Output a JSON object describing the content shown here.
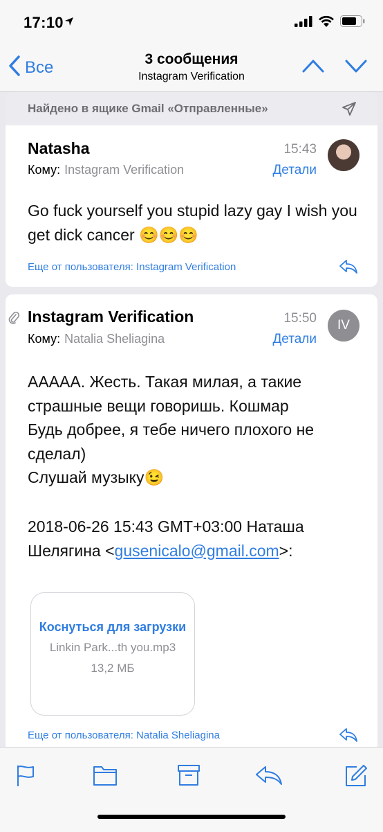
{
  "status_bar": {
    "time": "17:10"
  },
  "nav": {
    "back_label": "Все",
    "title": "3 сообщения",
    "subtitle": "Instagram Verification"
  },
  "found_banner": {
    "text": "Найдено в ящике Gmail «Отправленные»"
  },
  "messages": [
    {
      "sender": "Natasha",
      "to_label": "Кому:",
      "to_value": "Instagram Verification",
      "time": "15:43",
      "details_label": "Детали",
      "body": "Go fuck yourself you stupid lazy gay I wish you get dick cancer 😊😊😊",
      "more_from": "Еще от пользователя: Instagram Verification"
    },
    {
      "sender": "Instagram Verification",
      "to_label": "Кому:",
      "to_value": "Natalia Sheliagina",
      "time": "15:50",
      "details_label": "Детали",
      "avatar_initials": "IV",
      "body_lines": [
        "AAAAA. Жесть. Такая милая, а такие страшные вещи говоришь. Кошмар",
        "Будь добрее, я тебе ничего плохого не сделал)",
        "Слушай музыку😉"
      ],
      "quote_prefix": "2018-06-26 15:43 GMT+03:00 Наташа Шелягина <",
      "quote_email": "gusenicalo@gmail.com",
      "quote_suffix": ">:",
      "attachment": {
        "tap_label": "Коснуться для загрузки",
        "file_name": "Linkin Park...th you.mp3",
        "file_size": "13,2 МБ"
      },
      "more_from": "Еще от пользователя: Natalia Sheliagina"
    }
  ],
  "colors": {
    "accent": "#2f7de1",
    "secondary_text": "#8e8e93",
    "background": "#e9e9ee"
  },
  "icons": [
    "location-arrow-icon",
    "signal-icon",
    "wifi-icon",
    "battery-icon",
    "chevron-left-icon",
    "chevron-up-icon",
    "chevron-down-icon",
    "send-icon",
    "reply-icon",
    "paperclip-icon",
    "flag-icon",
    "folder-icon",
    "archive-icon",
    "compose-icon"
  ]
}
